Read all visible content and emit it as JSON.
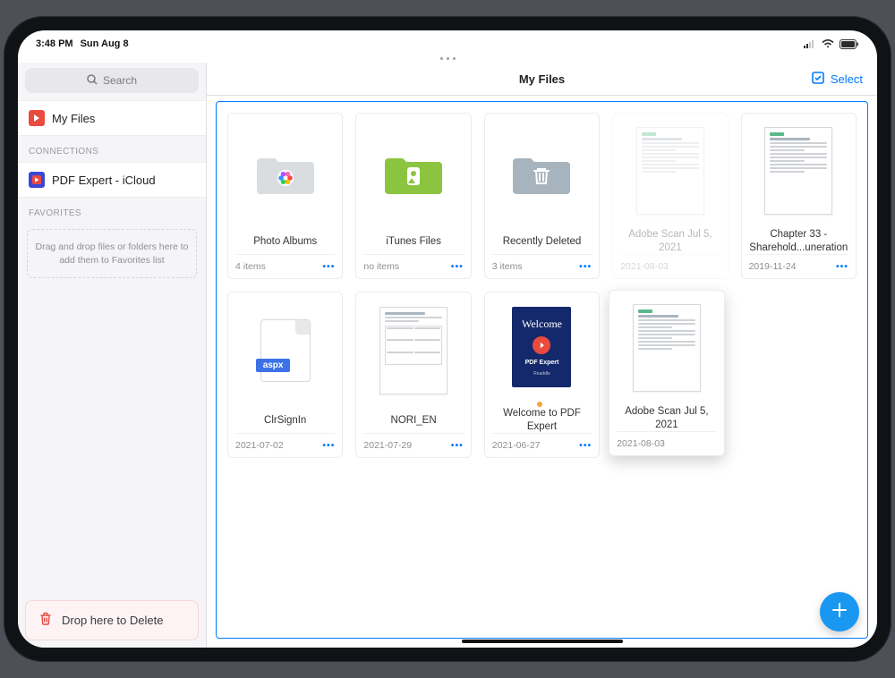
{
  "status": {
    "time": "3:48 PM",
    "date": "Sun Aug 8"
  },
  "search": {
    "placeholder": "Search"
  },
  "sidebar": {
    "my_files": "My Files",
    "connections_header": "CONNECTIONS",
    "pdf_expert": "PDF Expert - iCloud",
    "favorites_header": "FAVORITES",
    "favorites_hint": "Drag and drop files or folders here to add them to Favorites list",
    "delete_hint": "Drop here to Delete"
  },
  "toolbar": {
    "title": "My Files",
    "select": "Select"
  },
  "files": [
    {
      "name": "Photo Albums",
      "meta": "4 items",
      "type": "folder-photos"
    },
    {
      "name": "iTunes Files",
      "meta": "no items",
      "type": "folder-itunes"
    },
    {
      "name": "Recently Deleted",
      "meta": "3 items",
      "type": "folder-trash"
    },
    {
      "name": "Adobe Scan Jul 5, 2021",
      "meta": "2021-08-03",
      "type": "doc",
      "ghost": true
    },
    {
      "name": "Chapter 33 - Sharehold...uneration",
      "meta": "2019-11-24",
      "type": "doc"
    },
    {
      "name": "ClrSignIn",
      "meta": "2021-07-02",
      "type": "aspx",
      "tag": "aspx"
    },
    {
      "name": "NORI_EN",
      "meta": "2021-07-29",
      "type": "doc-form"
    },
    {
      "name": "Welcome to PDF Expert",
      "meta": "2021-06-27",
      "type": "welcome",
      "badge": true,
      "brand": "PDF Expert",
      "sub": "Readdle"
    },
    {
      "name": "Adobe Scan Jul 5, 2021",
      "meta": "2021-08-03",
      "type": "doc",
      "drag": true
    }
  ]
}
